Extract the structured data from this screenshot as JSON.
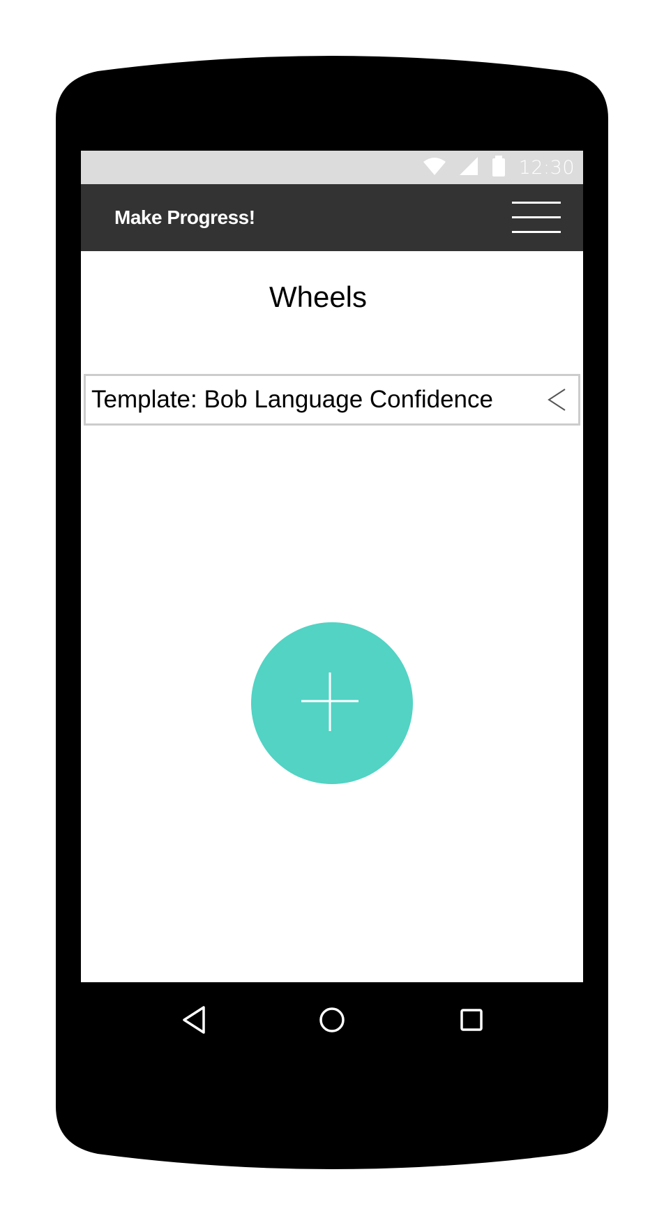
{
  "status_bar": {
    "time": "12:30",
    "icons": [
      "wifi-icon",
      "signal-icon",
      "battery-icon"
    ],
    "background": "#dcdcdc"
  },
  "app_bar": {
    "title": "Make Progress!",
    "menu_icon": "hamburger-menu-icon",
    "background": "#333333"
  },
  "page": {
    "title": "Wheels"
  },
  "list": {
    "items": [
      {
        "label": "Template: Bob Language Confidence",
        "icon": "chevron-left-icon"
      }
    ]
  },
  "fab": {
    "icon": "plus-icon",
    "color": "#52d3c4"
  },
  "nav_bar": {
    "buttons": [
      "back-icon",
      "home-icon",
      "recent-apps-icon"
    ]
  },
  "device": {
    "body_color": "#000000"
  }
}
